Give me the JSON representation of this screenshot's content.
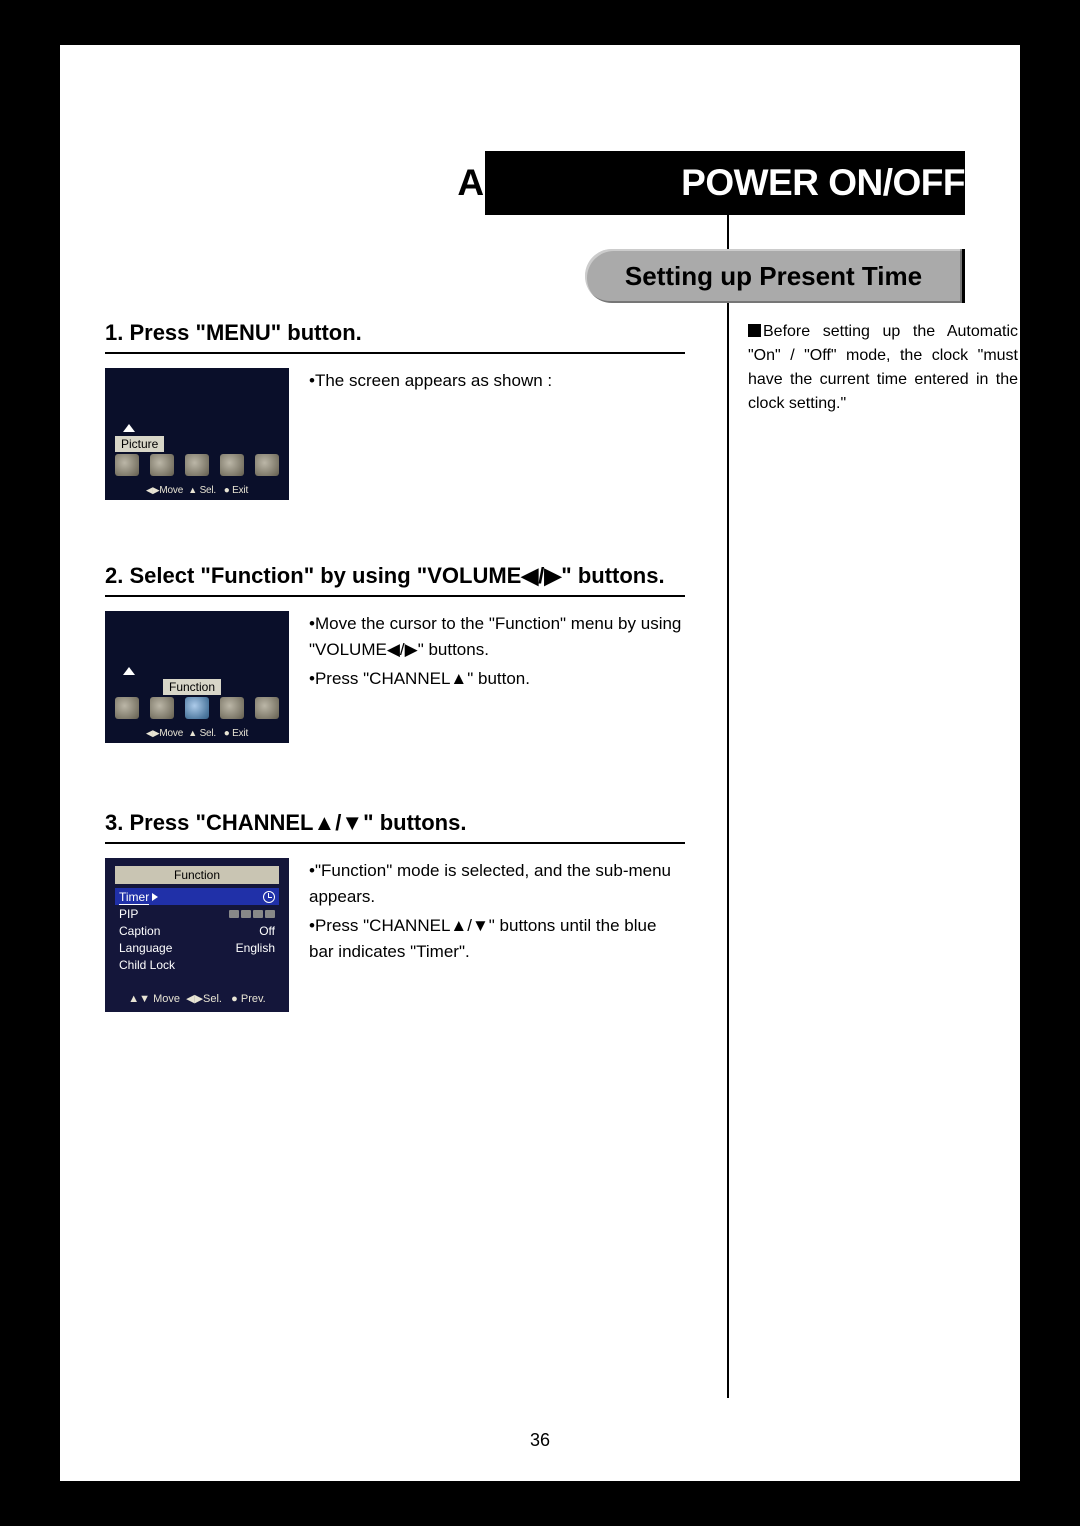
{
  "header": {
    "left": "AUTOMATIC",
    "right": " POWER ON/OFF"
  },
  "section_title": "Setting up Present Time",
  "note_right": "Before setting up the Automatic \"On\" / \"Off\" mode, the clock \"must have the current time entered in the clock setting.\"",
  "page_number": "36",
  "steps": [
    {
      "title": "1. Press \"MENU\" button.",
      "notes": [
        "The screen appears as shown :"
      ],
      "tv": {
        "type": "icon-row",
        "label": "Picture",
        "hint_move": "Move",
        "hint_sel": "Sel.",
        "hint_exit": "Exit"
      }
    },
    {
      "title": "2. Select \"Function\" by using \"VOLUME◀/▶\" buttons.",
      "notes": [
        "Move the cursor to the \"Function\" menu by using \"VOLUME◀/▶\" buttons.",
        "Press \"CHANNEL▲\" button."
      ],
      "tv": {
        "type": "icon-row",
        "label": "Function",
        "hint_move": "Move",
        "hint_sel": "Sel.",
        "hint_exit": "Exit"
      }
    },
    {
      "title": "3. Press \"CHANNEL▲/▼\" buttons.",
      "notes": [
        "\"Function\" mode is selected, and the sub-menu appears.",
        "Press \"CHANNEL▲/▼\" buttons until the blue bar indicates \"Timer\"."
      ],
      "tv": {
        "type": "submenu",
        "title": "Function",
        "rows": [
          {
            "name": "Timer",
            "value": "▶",
            "hl": true,
            "icon": "clock"
          },
          {
            "name": "PIP",
            "value": "icons"
          },
          {
            "name": "Caption",
            "value": "Off"
          },
          {
            "name": "Language",
            "value": "English"
          },
          {
            "name": "Child Lock",
            "value": ""
          }
        ],
        "hint_move": "Move",
        "hint_sel": "Sel.",
        "hint_prev": "Prev."
      }
    }
  ]
}
